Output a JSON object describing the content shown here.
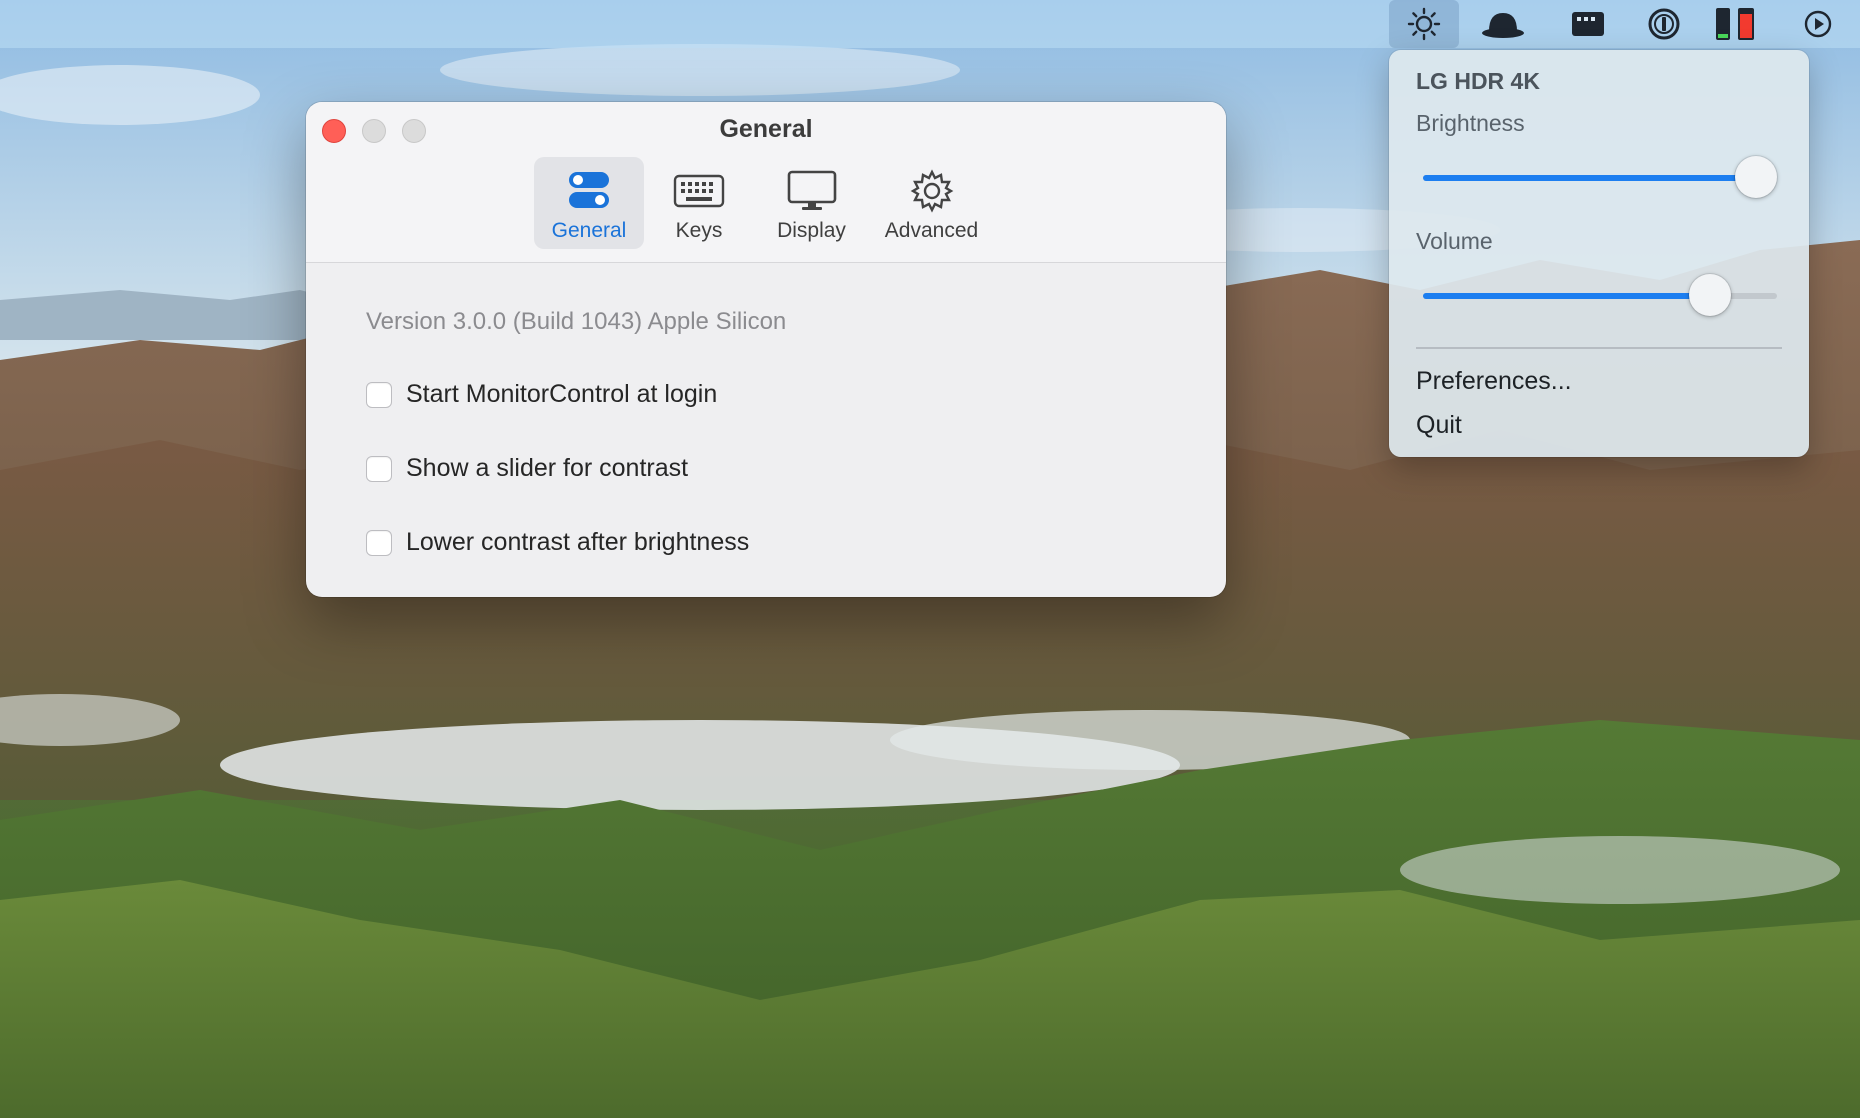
{
  "menubar": {
    "items": [
      {
        "icon": "brightness-icon",
        "active": true
      },
      {
        "icon": "incognito-icon"
      },
      {
        "icon": "window-icon"
      },
      {
        "icon": "1password-icon"
      },
      {
        "icon": "battery-bars-icon"
      },
      {
        "icon": "play-circle-icon"
      }
    ]
  },
  "window": {
    "title": "General",
    "tabs": [
      {
        "label": "General",
        "icon": "toggles-icon",
        "selected": true
      },
      {
        "label": "Keys",
        "icon": "keyboard-icon"
      },
      {
        "label": "Display",
        "icon": "display-icon"
      },
      {
        "label": "Advanced",
        "icon": "gear-icon"
      }
    ],
    "version": "Version 3.0.0 (Build 1043) Apple Silicon",
    "options": [
      {
        "label": "Start MonitorControl at login",
        "checked": false
      },
      {
        "label": "Show a slider for contrast",
        "checked": false
      },
      {
        "label": "Lower contrast after brightness",
        "checked": false
      }
    ]
  },
  "panel": {
    "display_name": "LG HDR 4K",
    "brightness_label": "Brightness",
    "brightness_value": 0.94,
    "volume_label": "Volume",
    "volume_value": 0.81,
    "menu": {
      "preferences": "Preferences...",
      "quit": "Quit"
    }
  },
  "colors": {
    "accent": "#1c7ef0",
    "close_button": "#ff5f57",
    "selected_tab_text": "#1a73d9"
  }
}
